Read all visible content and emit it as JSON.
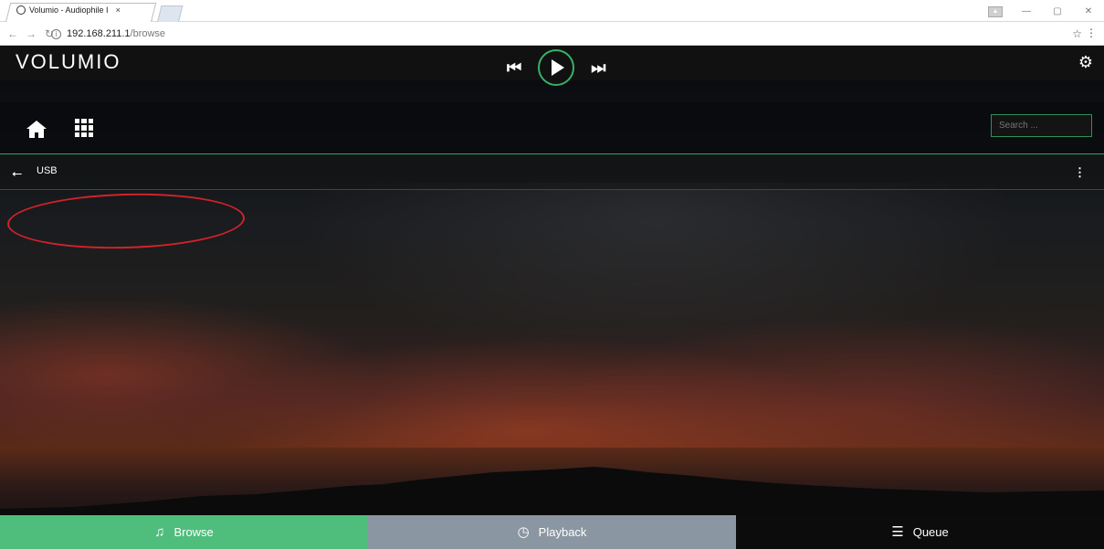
{
  "browser": {
    "tab_title": "Volumio - Audiophile I",
    "tab_close": "×",
    "url_host": "192.168.211.1",
    "url_path": "/browse"
  },
  "app": {
    "brand": "VOLUMIO",
    "search_placeholder": "Search ...",
    "list_item_label": "USB"
  },
  "bottom_tabs": [
    {
      "label": "Browse"
    },
    {
      "label": "Playback"
    },
    {
      "label": "Queue"
    }
  ],
  "colors": {
    "accent_green": "#4fbe7d",
    "playback_gray": "#8a96a1",
    "highlight_red": "#d2222a"
  }
}
